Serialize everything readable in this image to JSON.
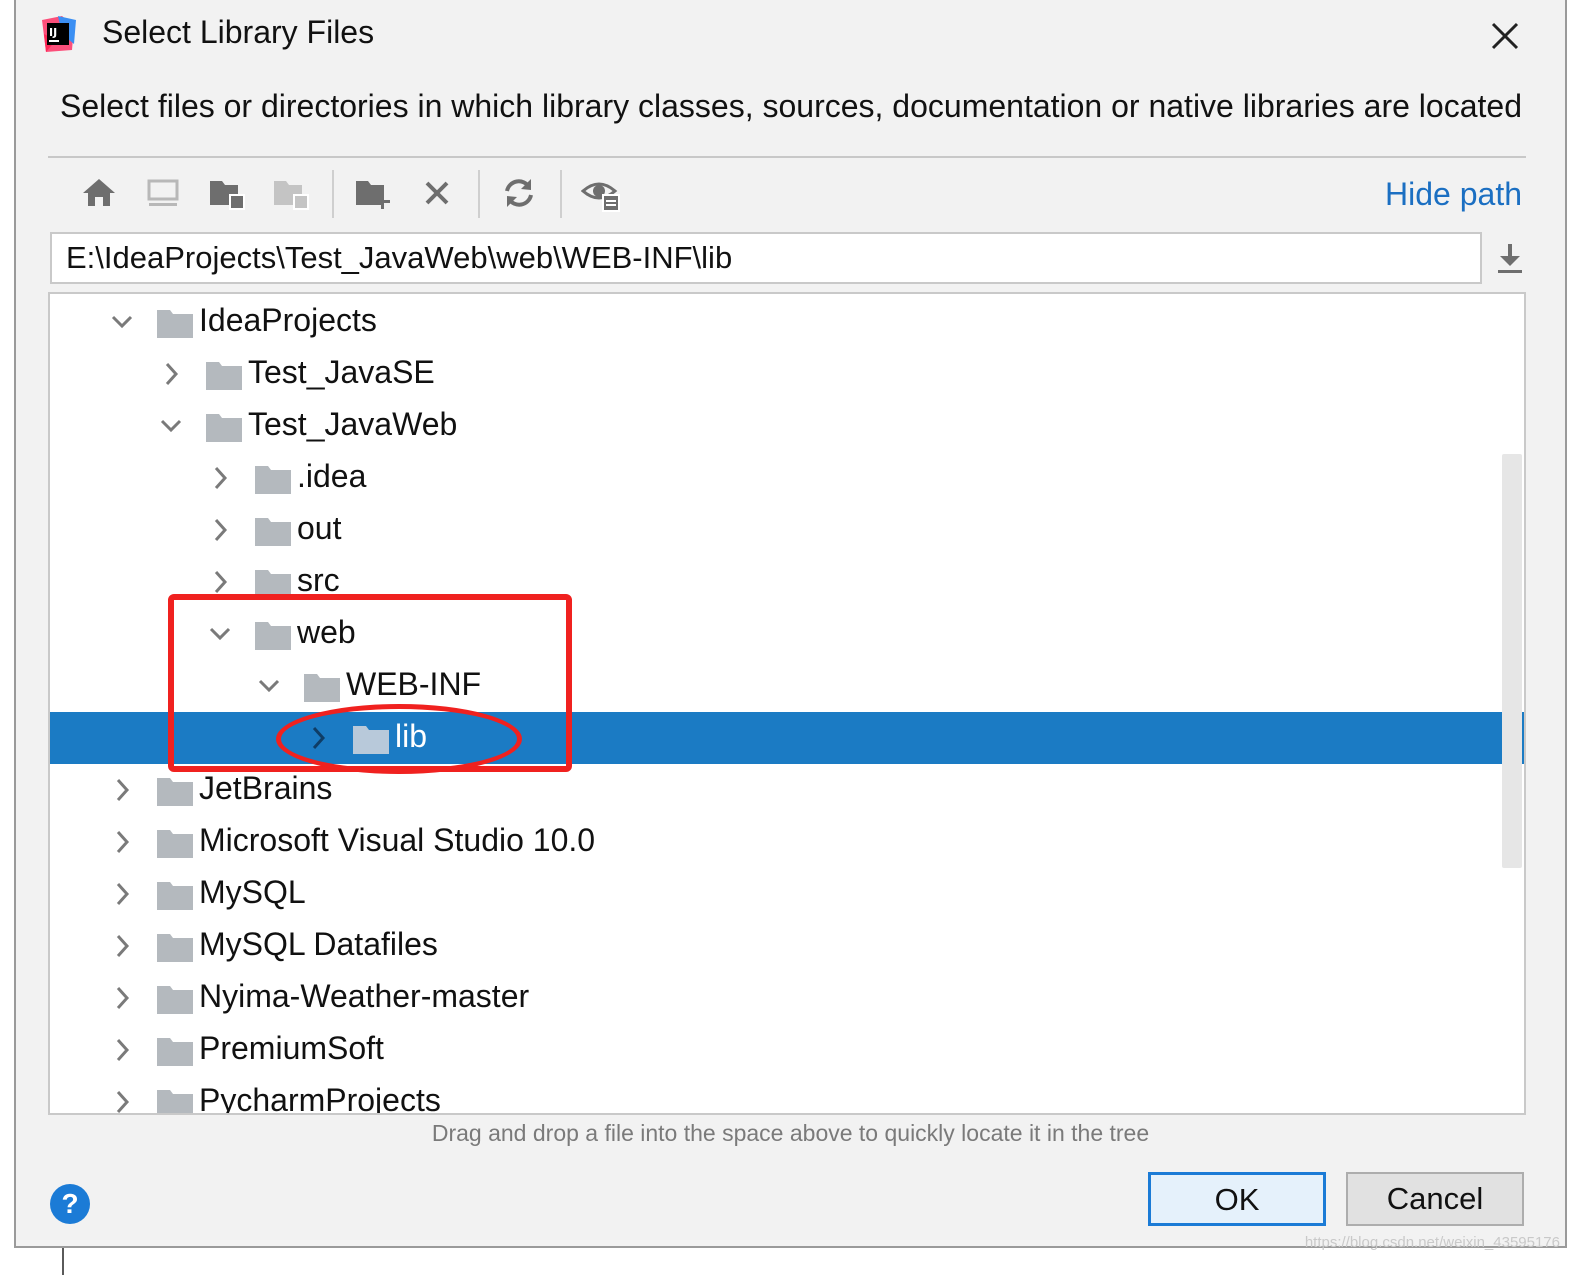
{
  "dialog": {
    "title": "Select Library Files",
    "description": "Select files or directories in which library classes, sources, documentation or native libraries are located",
    "hide_path_label": "Hide path",
    "path_value": "E:\\IdeaProjects\\Test_JavaWeb\\web\\WEB-INF\\lib",
    "hint": "Drag and drop a file into the space above to quickly locate it in the tree",
    "help_label": "?",
    "ok_label": "OK",
    "cancel_label": "Cancel"
  },
  "toolbar": {
    "icons": [
      "home-icon",
      "desktop-icon",
      "project-folder-icon",
      "module-folder-icon",
      "new-folder-icon",
      "delete-icon",
      "refresh-icon",
      "show-hidden-icon"
    ]
  },
  "tree": {
    "rows": [
      {
        "label": "IdeaProjects",
        "expanded": true,
        "level": 1
      },
      {
        "label": "Test_JavaSE",
        "expanded": false,
        "level": 2
      },
      {
        "label": "Test_JavaWeb",
        "expanded": true,
        "level": 2
      },
      {
        "label": ".idea",
        "expanded": false,
        "level": 3
      },
      {
        "label": "out",
        "expanded": false,
        "level": 3
      },
      {
        "label": "src",
        "expanded": false,
        "level": 3
      },
      {
        "label": "web",
        "expanded": true,
        "level": 3
      },
      {
        "label": "WEB-INF",
        "expanded": true,
        "level": 4
      },
      {
        "label": "lib",
        "expanded": false,
        "level": 5,
        "selected": true
      },
      {
        "label": "JetBrains",
        "expanded": false,
        "level": 1
      },
      {
        "label": "Microsoft Visual Studio 10.0",
        "expanded": false,
        "level": 1
      },
      {
        "label": "MySQL",
        "expanded": false,
        "level": 1
      },
      {
        "label": "MySQL Datafiles",
        "expanded": false,
        "level": 1
      },
      {
        "label": "Nyima-Weather-master",
        "expanded": false,
        "level": 1
      },
      {
        "label": "PremiumSoft",
        "expanded": false,
        "level": 1
      },
      {
        "label": "PycharmProjects",
        "expanded": false,
        "level": 1
      }
    ]
  },
  "watermark": "https://blog.csdn.net/weixin_43595176",
  "colors": {
    "selection": "#1b7bc4",
    "link": "#1b6fc2",
    "annotation": "#f0211f",
    "folder": "#b4b9be"
  }
}
